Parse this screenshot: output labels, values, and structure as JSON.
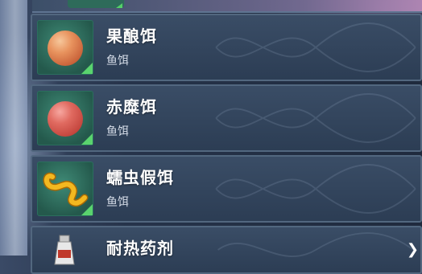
{
  "items": [
    {
      "name": "果酿饵",
      "category": "鱼饵",
      "icon": "orange-bait-ball-icon",
      "color": "#e8935e"
    },
    {
      "name": "赤糜饵",
      "category": "鱼饵",
      "icon": "red-bait-ball-icon",
      "color": "#e06a60"
    },
    {
      "name": "蠕虫假饵",
      "category": "鱼饵",
      "icon": "worm-lure-icon",
      "color": "#f0b422"
    },
    {
      "name": "耐热药剂",
      "category": "",
      "icon": "potion-bottle-icon"
    }
  ],
  "scroll_indicator": "❯",
  "accent_color": "#5ad36e"
}
